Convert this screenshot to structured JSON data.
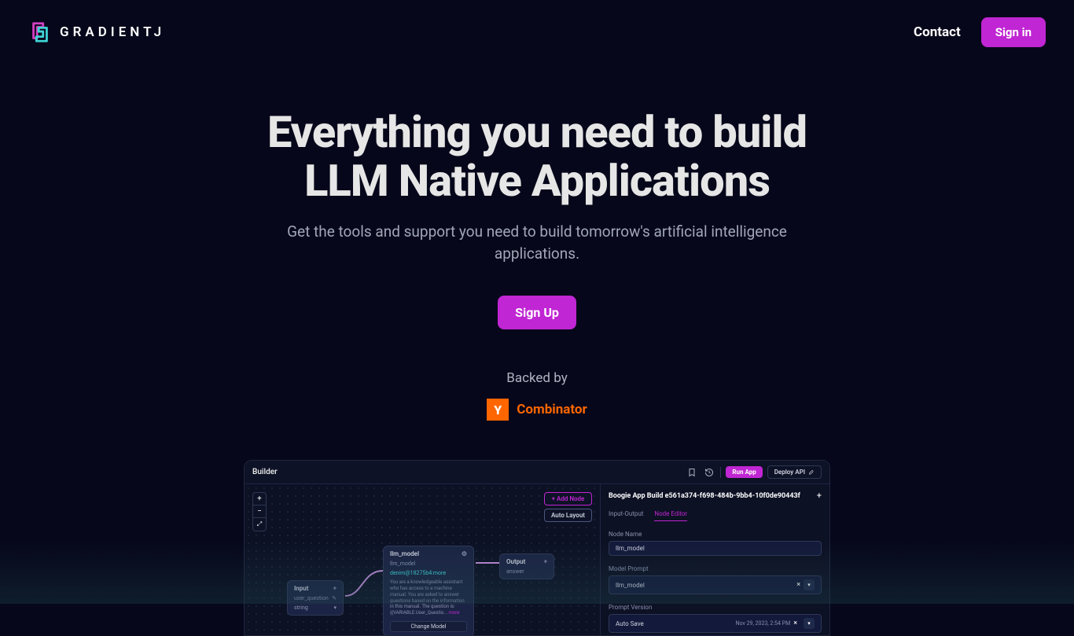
{
  "brand": {
    "name": "GRADIENTJ"
  },
  "nav": {
    "contact": "Contact",
    "signin": "Sign in"
  },
  "hero": {
    "headline_l1": "Everything you need to build",
    "headline_l2": "LLM Native Applications",
    "subhead": "Get the tools and support you need to build tomorrow's artificial intelligence applications.",
    "cta": "Sign Up"
  },
  "backed": {
    "label": "Backed by",
    "yc": "Combinator",
    "y": "Y"
  },
  "shot": {
    "title": "Builder",
    "run": "Run App",
    "deploy": "Deploy API",
    "addNode": "+  Add Node",
    "autoLayout": "Auto Layout",
    "zoom": {
      "plus": "+",
      "minus": "−",
      "reset": "⤢"
    },
    "input": {
      "title": "Input",
      "field1": "user_question",
      "field2": "string"
    },
    "model": {
      "title": "llm_model",
      "sub": "llm_model",
      "engine": "denim@18275b4:more",
      "body": "You are a knowledgeable assistant who has access to a machine manual. You are asked to answer questions based on the information in this manual. The question is: {{VARIABLE.User_Questio...",
      "more": "more",
      "change": "Change Model"
    },
    "output": {
      "title": "Output",
      "field1": "answer"
    },
    "panel": {
      "title": "Boogie App Build e561a374-f698-484b-9bb4-10f0de90443f",
      "tab1": "Input-Output",
      "tab2": "Node Editor",
      "nodeNameLabel": "Node Name",
      "nodeName": "llm_model",
      "modelPromptLabel": "Model Prompt",
      "modelPrompt": "llm_model",
      "promptVersionLabel": "Prompt Version",
      "promptVersion": "Auto Save",
      "promptTime": "Nov 29, 2023, 2:54 PM"
    }
  }
}
